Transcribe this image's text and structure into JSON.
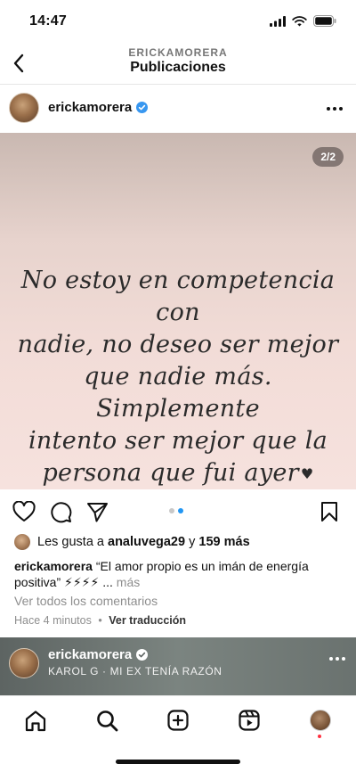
{
  "status_bar": {
    "time": "14:47"
  },
  "header": {
    "username": "ERICKAMORERA",
    "title": "Publicaciones"
  },
  "post": {
    "username": "erickamorera",
    "page_counter": "2/2",
    "quote_lines": [
      "No estoy en competencia con",
      "nadie, no deseo ser mejor",
      "que nadie más. Simplemente",
      "intento ser mejor que la",
      "persona que fui ayer"
    ],
    "heart_glyph": "♥",
    "carousel": {
      "total": 2,
      "current": 2
    },
    "likes": {
      "prefix": "Les gusta a",
      "liker": "analuvega29",
      "joiner": "y",
      "others": "159 más"
    },
    "caption": {
      "username": "erickamorera",
      "text": "“El amor propio es un imán de energía positiva” ⚡⚡⚡⚡",
      "ellipsis": "...",
      "more": "más"
    },
    "comments_link": "Ver todos los comentarios",
    "time_ago": "Hace 4 minutos",
    "separator": "•",
    "translate": "Ver traducción"
  },
  "next_post": {
    "username": "erickamorera",
    "music": "KAROL G · MI EX TENÍA RAZÓN"
  },
  "colors": {
    "accent_blue": "#2196f3",
    "verified_blue": "#3897f0",
    "notif_red": "#ff3040"
  },
  "tab_bar": {
    "items": [
      {
        "icon": "home-icon"
      },
      {
        "icon": "search-icon"
      },
      {
        "icon": "create-icon"
      },
      {
        "icon": "reels-icon"
      },
      {
        "icon": "profile-avatar"
      }
    ]
  }
}
